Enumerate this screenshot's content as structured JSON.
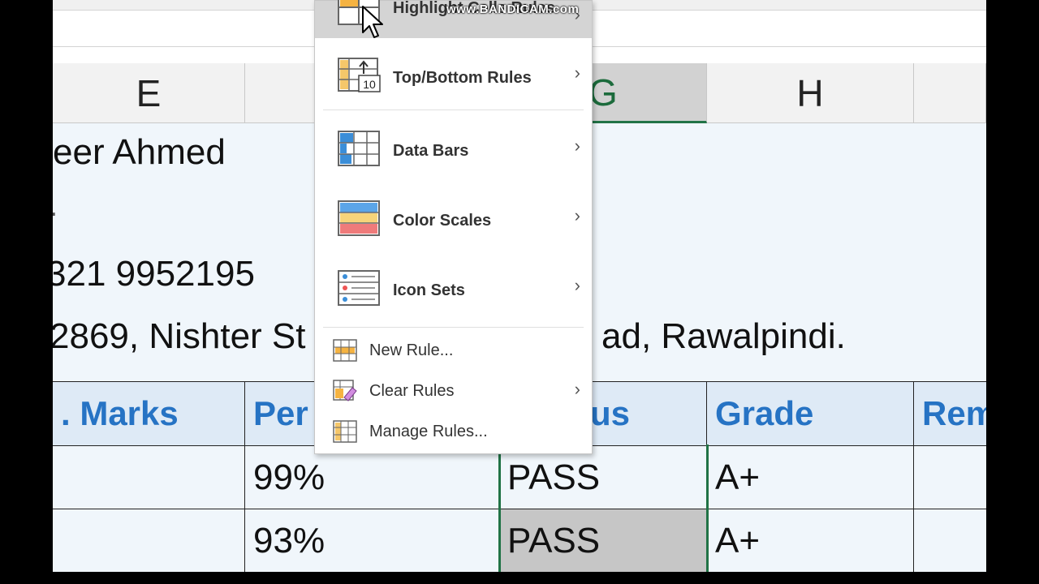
{
  "watermark": "www.BANDICAM.com",
  "columns": {
    "e": "E",
    "g": "G",
    "h": "H"
  },
  "info": {
    "name": "eer Ahmed",
    "dot": ".",
    "phone": "321 9952195",
    "address_left": "2869, Nishter St",
    "address_right": "ad, Rawalpindi."
  },
  "table": {
    "headers": [
      ". Marks",
      "Per",
      "us",
      "Grade",
      "Rem"
    ],
    "rows": [
      [
        "",
        "99%",
        "PASS",
        "A+",
        ""
      ],
      [
        "",
        "93%",
        "PASS",
        "A+",
        ""
      ]
    ]
  },
  "menu": {
    "items": [
      {
        "label": "Highlight Cells Rules",
        "icon": "highlight-cells-icon"
      },
      {
        "label": "Top/Bottom Rules",
        "icon": "top-bottom-icon",
        "icon_text": "10"
      },
      {
        "label": "Data Bars",
        "icon": "data-bars-icon"
      },
      {
        "label": "Color Scales",
        "icon": "color-scales-icon"
      },
      {
        "label": "Icon Sets",
        "icon": "icon-sets-icon"
      },
      {
        "label": "New Rule...",
        "icon": "new-rule-icon"
      },
      {
        "label": "Clear Rules",
        "icon": "clear-rules-icon"
      },
      {
        "label": "Manage Rules...",
        "icon": "manage-rules-icon"
      }
    ],
    "submenu_arrow": "›"
  },
  "colors": {
    "accent_blue": "#2673c4",
    "excel_green": "#217346"
  }
}
